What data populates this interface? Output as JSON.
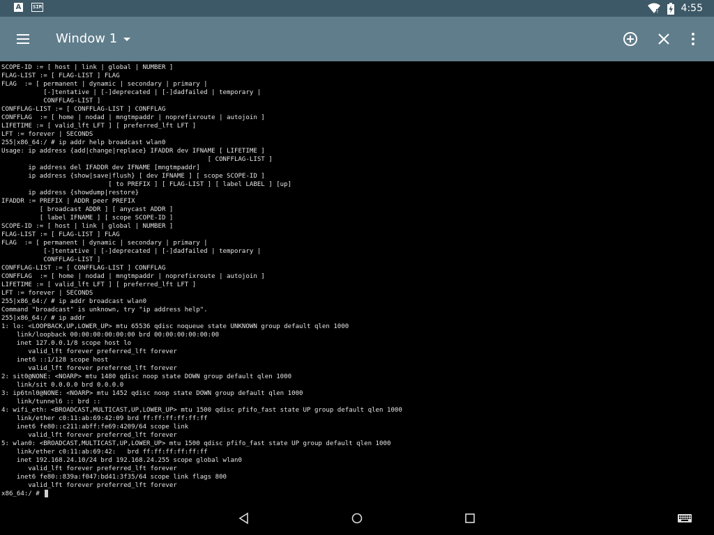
{
  "status_bar": {
    "time": "4:55",
    "left_icons": [
      "text-a-icon",
      "sim-card-icon"
    ],
    "app_badge_letter": "A",
    "sim_badge_text": "SIM",
    "right_icons": [
      "wifi-icon",
      "battery-icon"
    ]
  },
  "toolbar": {
    "window_title": "Window 1",
    "icons": [
      "menu-icon",
      "chevron-down-icon",
      "add-circle-icon",
      "close-icon",
      "more-vert-icon"
    ]
  },
  "terminal": {
    "lines": [
      "SCOPE-ID := [ host | link | global | NUMBER ]",
      "FLAG-LIST := [ FLAG-LIST ] FLAG",
      "FLAG  := [ permanent | dynamic | secondary | primary |",
      "           [-]tentative | [-]deprecated | [-]dadfailed | temporary |",
      "           CONFFLAG-LIST ]",
      "CONFFLAG-LIST := [ CONFFLAG-LIST ] CONFFLAG",
      "CONFFLAG  := [ home | nodad | mngtmpaddr | noprefixroute | autojoin ]",
      "LIFETIME := [ valid_lft LFT ] [ preferred_lft LFT ]",
      "LFT := forever | SECONDS",
      "255|x86_64:/ # ip addr help broadcast wlan0",
      "Usage: ip address {add|change|replace} IFADDR dev IFNAME [ LIFETIME ]",
      "                                                      [ CONFFLAG-LIST ]",
      "       ip address del IFADDR dev IFNAME [mngtmpaddr]",
      "       ip address {show|save|flush} [ dev IFNAME ] [ scope SCOPE-ID ]",
      "                            [ to PREFIX ] [ FLAG-LIST ] [ label LABEL ] [up]",
      "       ip address {showdump|restore}",
      "IFADDR := PREFIX | ADDR peer PREFIX",
      "          [ broadcast ADDR ] [ anycast ADDR ]",
      "          [ label IFNAME ] [ scope SCOPE-ID ]",
      "SCOPE-ID := [ host | link | global | NUMBER ]",
      "FLAG-LIST := [ FLAG-LIST ] FLAG",
      "FLAG  := [ permanent | dynamic | secondary | primary |",
      "           [-]tentative | [-]deprecated | [-]dadfailed | temporary |",
      "           CONFFLAG-LIST ]",
      "CONFFLAG-LIST := [ CONFFLAG-LIST ] CONFFLAG",
      "CONFFLAG  := [ home | nodad | mngtmpaddr | noprefixroute | autojoin ]",
      "LIFETIME := [ valid_lft LFT ] [ preferred_lft LFT ]",
      "LFT := forever | SECONDS",
      "255|x86_64:/ # ip addr broadcast wlan0",
      "Command \"broadcast\" is unknown, try \"ip address help\".",
      "255|x86_64:/ # ip addr",
      "1: lo: <LOOPBACK,UP,LOWER_UP> mtu 65536 qdisc noqueue state UNKNOWN group default qlen 1000",
      "    link/loopback 00:00:00:00:00:00 brd 00:00:00:00:00:00",
      "    inet 127.0.0.1/8 scope host lo",
      "       valid_lft forever preferred_lft forever",
      "    inet6 ::1/128 scope host",
      "       valid_lft forever preferred_lft forever",
      "2: sit0@NONE: <NOARP> mtu 1480 qdisc noop state DOWN group default qlen 1000",
      "    link/sit 0.0.0.0 brd 0.0.0.0",
      "3: ip6tnl0@NONE: <NOARP> mtu 1452 qdisc noop state DOWN group default qlen 1000",
      "    link/tunnel6 :: brd ::",
      "4: wifi_eth: <BROADCAST,MULTICAST,UP,LOWER_UP> mtu 1500 qdisc pfifo_fast state UP group default qlen 1000",
      "    link/ether c0:11:ab:69:42:09 brd ff:ff:ff:ff:ff:ff",
      "    inet6 fe80::c211:abff:fe69:4209/64 scope link",
      "       valid_lft forever preferred_lft forever",
      "5: wlan0: <BROADCAST,MULTICAST,UP,LOWER_UP> mtu 1500 qdisc pfifo_fast state UP group default qlen 1000",
      "    link/ether c0:11:ab:69:42:   brd ff:ff:ff:ff:ff:ff",
      "    inet 192.168.24.10/24 brd 192.168.24.255 scope global wlan0",
      "       valid_lft forever preferred_lft forever",
      "    inet6 fe80::839a:f047:bd41:3f35/64 scope link flags 800",
      "       valid_lft forever preferred_lft forever"
    ],
    "prompt": "x86_64:/ # "
  },
  "nav_bar": {
    "icons": [
      "back-icon",
      "home-icon",
      "recents-icon",
      "keyboard-icon"
    ]
  },
  "colors": {
    "status_bar_bg": "#3d5866",
    "toolbar_bg": "#607d8b",
    "terminal_bg": "#000000",
    "terminal_fg": "#e6e6e6"
  }
}
